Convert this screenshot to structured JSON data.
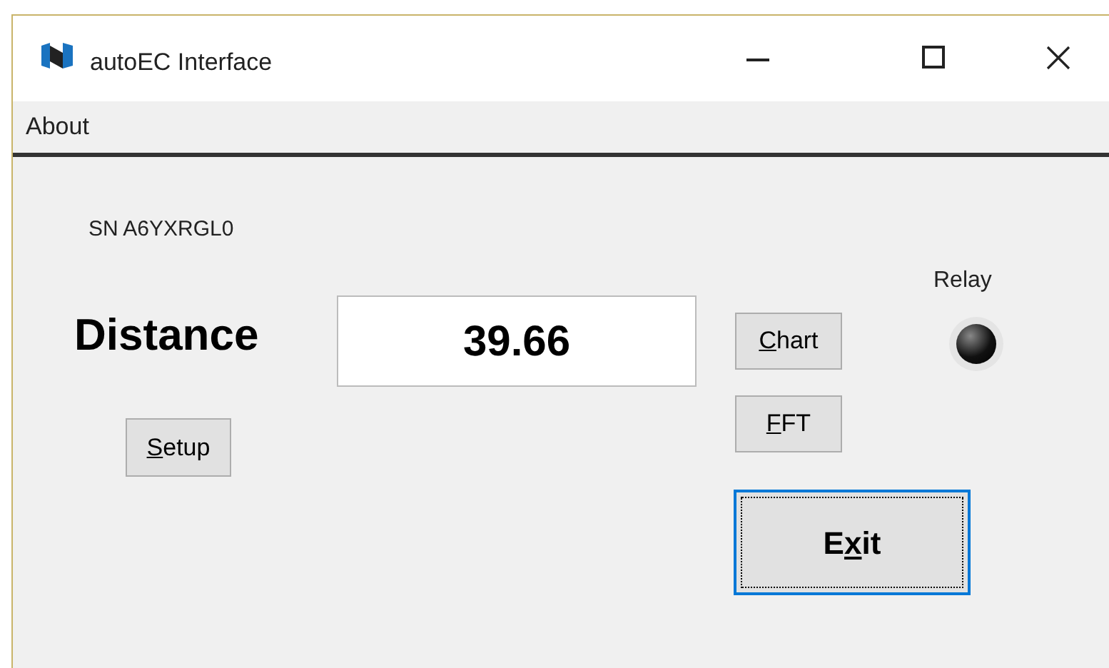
{
  "window": {
    "title": "autoEC Interface"
  },
  "menu": [
    "About"
  ],
  "serial_label": "SN A6YXRGL0",
  "distance": {
    "label": "Distance",
    "value": "39.66"
  },
  "buttons": [
    {
      "access_key": "S",
      "label_after": "etup",
      "focused": false
    },
    {
      "access_key": "C",
      "label_after": "hart",
      "focused": false
    },
    {
      "access_key": "F",
      "label_after": "FT",
      "focused": false
    },
    {
      "label_before": "E",
      "access_key": "x",
      "label_after": "it",
      "focused": true
    }
  ],
  "relay": {
    "label": "Relay",
    "on": false
  }
}
